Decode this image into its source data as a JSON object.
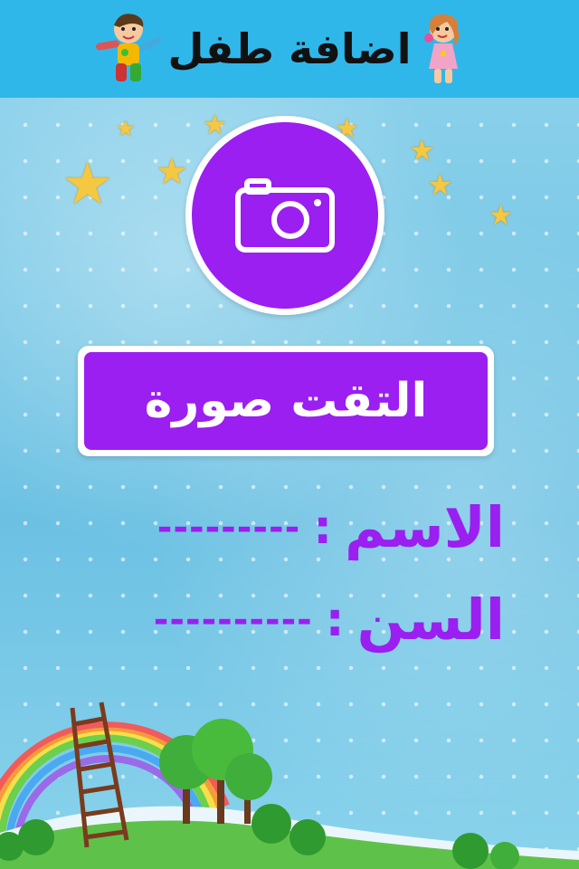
{
  "header": {
    "title": "اضافة طفل"
  },
  "photo": {
    "camera_icon": "camera-icon",
    "button_label": "التقت صورة"
  },
  "form": {
    "name_label": "الاسم",
    "name_value": "---------",
    "age_label": "السن",
    "age_value": "----------",
    "colon": ":"
  },
  "colors": {
    "header": "#30b7ea",
    "accent": "#9a1ff0",
    "background": "#7ccbe8"
  }
}
